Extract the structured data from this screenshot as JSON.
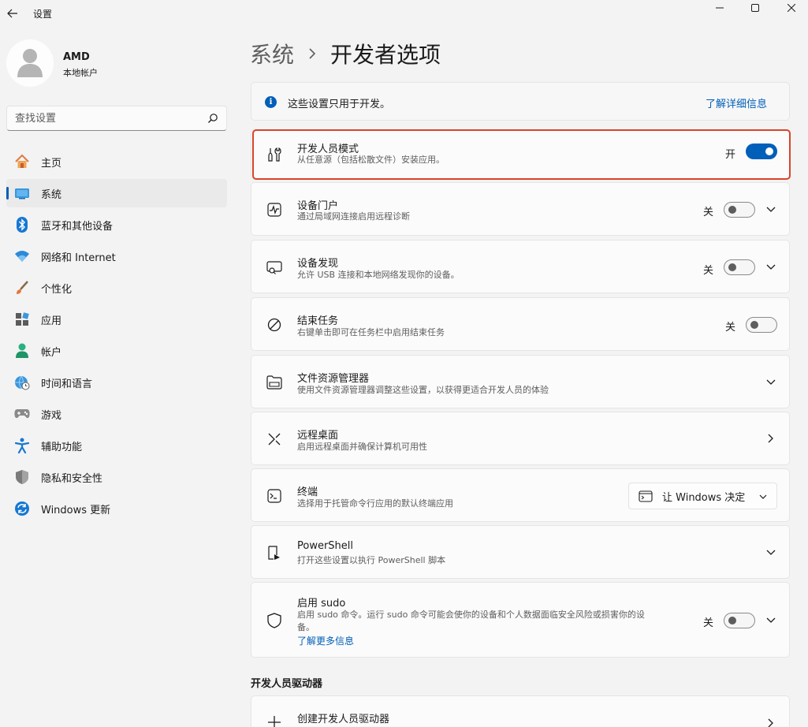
{
  "app": {
    "title": "设置"
  },
  "profile": {
    "name": "AMD",
    "account_type": "本地帐户"
  },
  "search": {
    "placeholder": "查找设置"
  },
  "nav": {
    "items": [
      {
        "label": "主页",
        "icon": "home-icon"
      },
      {
        "label": "系统",
        "icon": "system-icon",
        "active": true
      },
      {
        "label": "蓝牙和其他设备",
        "icon": "bluetooth-icon"
      },
      {
        "label": "网络和 Internet",
        "icon": "wifi-icon"
      },
      {
        "label": "个性化",
        "icon": "brush-icon"
      },
      {
        "label": "应用",
        "icon": "apps-icon"
      },
      {
        "label": "帐户",
        "icon": "account-icon"
      },
      {
        "label": "时间和语言",
        "icon": "globe-clock-icon"
      },
      {
        "label": "游戏",
        "icon": "gamepad-icon"
      },
      {
        "label": "辅助功能",
        "icon": "accessibility-icon"
      },
      {
        "label": "隐私和安全性",
        "icon": "shield-icon"
      },
      {
        "label": "Windows 更新",
        "icon": "update-icon"
      }
    ]
  },
  "breadcrumb": {
    "parent": "系统",
    "current": "开发者选项"
  },
  "info": {
    "text": "这些设置只用于开发。",
    "link": "了解详细信息"
  },
  "settings": {
    "dev_mode": {
      "title": "开发人员模式",
      "subtitle": "从任意源（包括松散文件）安装应用。",
      "state": "开",
      "on": true
    },
    "device_portal": {
      "title": "设备门户",
      "subtitle": "通过局域网连接启用远程诊断",
      "state": "关",
      "on": false
    },
    "device_discovery": {
      "title": "设备发现",
      "subtitle": "允许 USB 连接和本地网络发现你的设备。",
      "state": "关",
      "on": false
    },
    "end_task": {
      "title": "结束任务",
      "subtitle": "右键单击即可在任务栏中启用结束任务",
      "state": "关",
      "on": false
    },
    "file_explorer": {
      "title": "文件资源管理器",
      "subtitle": "使用文件资源管理器调整这些设置，以获得更适合开发人员的体验"
    },
    "remote_desktop": {
      "title": "远程桌面",
      "subtitle": "启用远程桌面并确保计算机可用性"
    },
    "terminal": {
      "title": "终端",
      "subtitle": "选择用于托管命令行应用的默认终端应用",
      "dropdown_value": "让 Windows 决定"
    },
    "powershell": {
      "title": "PowerShell",
      "subtitle": "打开这些设置以执行 PowerShell 脚本"
    },
    "sudo": {
      "title": "启用 sudo",
      "subtitle_line1": "启用 sudo 命令。运行 sudo 命令可能会使你的设备和个人数据面临安全风险或损害你的设",
      "subtitle_line2": "备。",
      "link": "了解更多信息",
      "state": "关",
      "on": false
    }
  },
  "drivers_section": {
    "header": "开发人员驱动器",
    "create": {
      "title": "创建开发人员驱动器"
    }
  },
  "colors": {
    "accent": "#005fb8",
    "highlight_border": "#d9432b"
  }
}
